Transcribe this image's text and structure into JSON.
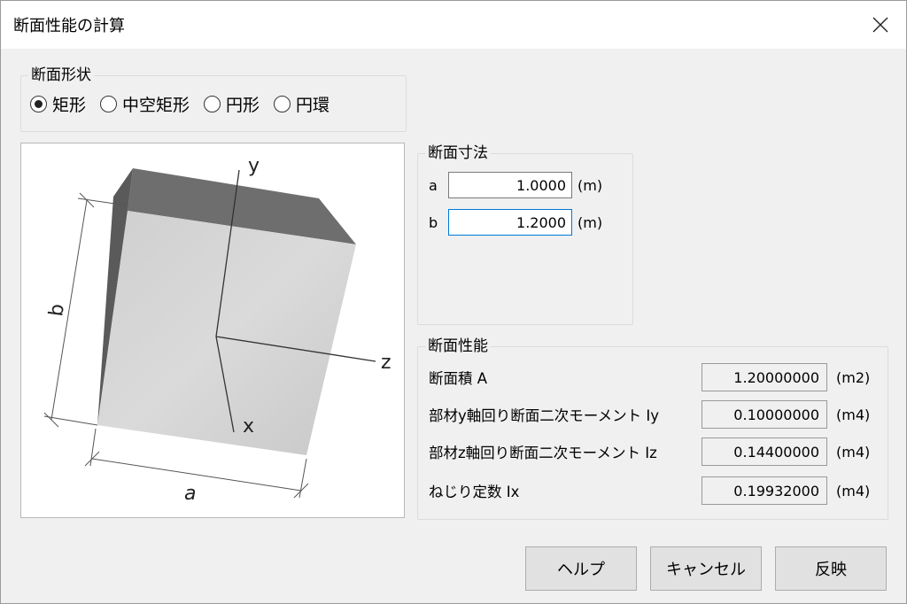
{
  "window": {
    "title": "断面性能の計算",
    "close_icon": "close-icon"
  },
  "shape": {
    "legend": "断面形状",
    "options": [
      {
        "label": "矩形",
        "checked": true
      },
      {
        "label": "中空矩形",
        "checked": false
      },
      {
        "label": "円形",
        "checked": false
      },
      {
        "label": "円環",
        "checked": false
      }
    ]
  },
  "diagram": {
    "axis_y": "y",
    "axis_z": "z",
    "axis_x": "x",
    "dim_a": "a",
    "dim_b": "b"
  },
  "dims": {
    "legend": "断面寸法",
    "rows": [
      {
        "label": "a",
        "value": "1.0000",
        "unit": "(m)"
      },
      {
        "label": "b",
        "value": "1.2000",
        "unit": "(m)"
      }
    ]
  },
  "props": {
    "legend": "断面性能",
    "rows": [
      {
        "label": "断面積 A",
        "value": "1.20000000",
        "unit": "(m2)"
      },
      {
        "label": "部材y軸回り断面二次モーメント Iy",
        "value": "0.10000000",
        "unit": "(m4)"
      },
      {
        "label": "部材z軸回り断面二次モーメント Iz",
        "value": "0.14400000",
        "unit": "(m4)"
      },
      {
        "label": "ねじり定数 Ix",
        "value": "0.19932000",
        "unit": "(m4)"
      }
    ]
  },
  "buttons": {
    "help": "ヘルプ",
    "cancel": "キャンセル",
    "apply": "反映"
  },
  "colors": {
    "accent": "#0078d7",
    "panel": "#f0f0f0",
    "block_face": "#d4d4d4",
    "block_top": "#6e6e6e"
  }
}
